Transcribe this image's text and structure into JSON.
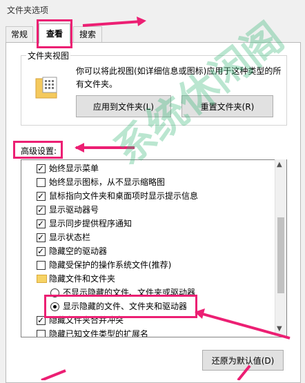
{
  "window": {
    "title": "文件夹选项"
  },
  "tabs": [
    {
      "label": "常规",
      "active": false
    },
    {
      "label": "查看",
      "active": true
    },
    {
      "label": "搜索",
      "active": false
    }
  ],
  "folder_views": {
    "label": "文件夹视图",
    "description": "你可以将此视图(如详细信息或图标)应用于这种类型的所有文件夹。",
    "apply_button": "应用到文件夹(L)",
    "reset_button": "重置文件夹(R)",
    "icon": "folder-icon"
  },
  "advanced": {
    "label": "高级设置:",
    "items": [
      {
        "type": "checkbox",
        "checked": true,
        "label": "始终显示菜单"
      },
      {
        "type": "checkbox",
        "checked": false,
        "label": "始终显示图标，从不显示缩略图"
      },
      {
        "type": "checkbox",
        "checked": true,
        "label": "鼠标指向文件夹和桌面项时显示提示信息"
      },
      {
        "type": "checkbox",
        "checked": true,
        "label": "显示驱动器号"
      },
      {
        "type": "checkbox",
        "checked": true,
        "label": "显示同步提供程序通知"
      },
      {
        "type": "checkbox",
        "checked": true,
        "label": "显示状态栏"
      },
      {
        "type": "checkbox",
        "checked": true,
        "label": "隐藏空的驱动器"
      },
      {
        "type": "checkbox",
        "checked": false,
        "label": "隐藏受保护的操作系统文件(推荐)"
      },
      {
        "type": "folder",
        "label": "隐藏文件和文件夹"
      },
      {
        "type": "radio",
        "checked": false,
        "label": "不显示隐藏的文件、文件夹或驱动器"
      },
      {
        "type": "radio",
        "checked": true,
        "label": "显示隐藏的文件、文件夹和驱动器"
      },
      {
        "type": "checkbox",
        "checked": true,
        "label": "隐藏文件夹合并冲突"
      },
      {
        "type": "checkbox",
        "checked": false,
        "label": "隐藏已知文件类型的扩展名"
      }
    ],
    "restore_button": "还原为默认值(D)"
  },
  "watermark": "系统休闲阁",
  "colors": {
    "highlight": "#ec1f73",
    "watermark": "#3cb87a"
  }
}
